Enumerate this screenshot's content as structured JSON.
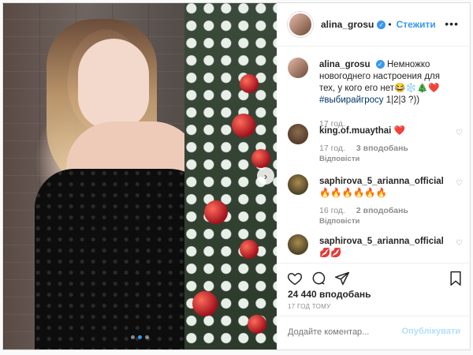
{
  "post": {
    "username": "alina_grosu",
    "follow_label": "Стежити",
    "more_label": "•••",
    "caption": {
      "username": "alina_grosu",
      "text": "Немножко новогоднего настроения для тех, у кого его нет😂❄️🎄❤️",
      "hashtag": "#выбирайгросу",
      "suffix": "1|2|3 ?))",
      "time": "17 год."
    },
    "comments": [
      {
        "username": "king.of.muaythai",
        "text": "❤️",
        "time": "17 год.",
        "likes": "3 вподобань",
        "reply": "Відповісти"
      },
      {
        "username": "saphirova_5_arianna_official",
        "text": "🔥🔥🔥🔥🔥🔥",
        "time": "16 год.",
        "likes": "2 вподобань",
        "reply": "Відповісти"
      },
      {
        "username": "saphirova_5_arianna_official",
        "text": "💋💋"
      }
    ],
    "likes_text": "24 440 вподобань",
    "time_ago": "17 ГОД ТОМУ",
    "comment_placeholder": "Додайте коментар...",
    "publish_label": "Опублікувати"
  },
  "carousel": {
    "current": 2,
    "total": 3
  },
  "colors": {
    "accent": "#3897f0",
    "heart": "#ed4956"
  }
}
